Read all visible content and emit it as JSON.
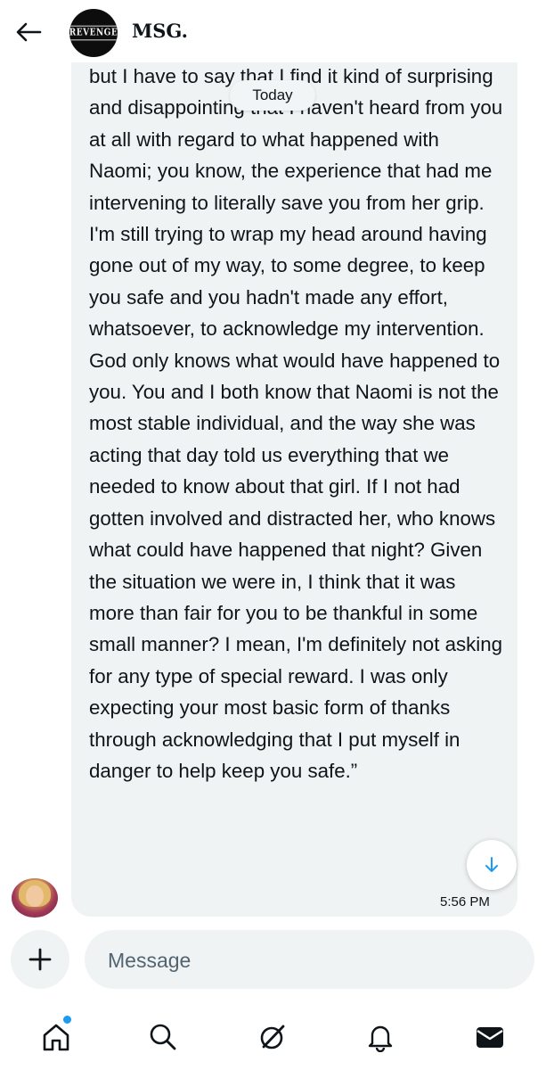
{
  "header": {
    "title": "MSG.",
    "avatar_label": "REVENGE"
  },
  "conversation": {
    "date_divider": "Today",
    "message": {
      "text": "but I have to say that I find it kind of surprising and disappointing that I haven't heard from you at all with regard to what happened with Naomi; you know, the experience that had me intervening to literally save you from her grip. I'm still trying to wrap my head around having gone out of my way, to some degree, to keep you safe and you hadn't made any effort, whatsoever, to acknowledge my intervention. God only knows what would have happened to you. You and I both know that Naomi is not the most stable individual, and the way she was acting that day told us everything that we needed to know about that girl. If I not had gotten involved and distracted her, who knows what could have happened that night? Given the situation we were in, I think that it was more than fair for you to be thankful in some small manner? I mean, I'm definitely not asking for any type of special reward. I was only expecting your most basic form of thanks through acknowledging that I put myself in danger to help keep you safe.”",
      "time": "5:56 PM"
    }
  },
  "composer": {
    "placeholder": "Message"
  },
  "nav": {
    "items": [
      "home-icon",
      "search-icon",
      "grok-icon",
      "notifications-icon",
      "messages-icon"
    ]
  },
  "colors": {
    "bubble": "#eff3f4",
    "accent": "#1d9bf0",
    "text": "#0f1419"
  }
}
